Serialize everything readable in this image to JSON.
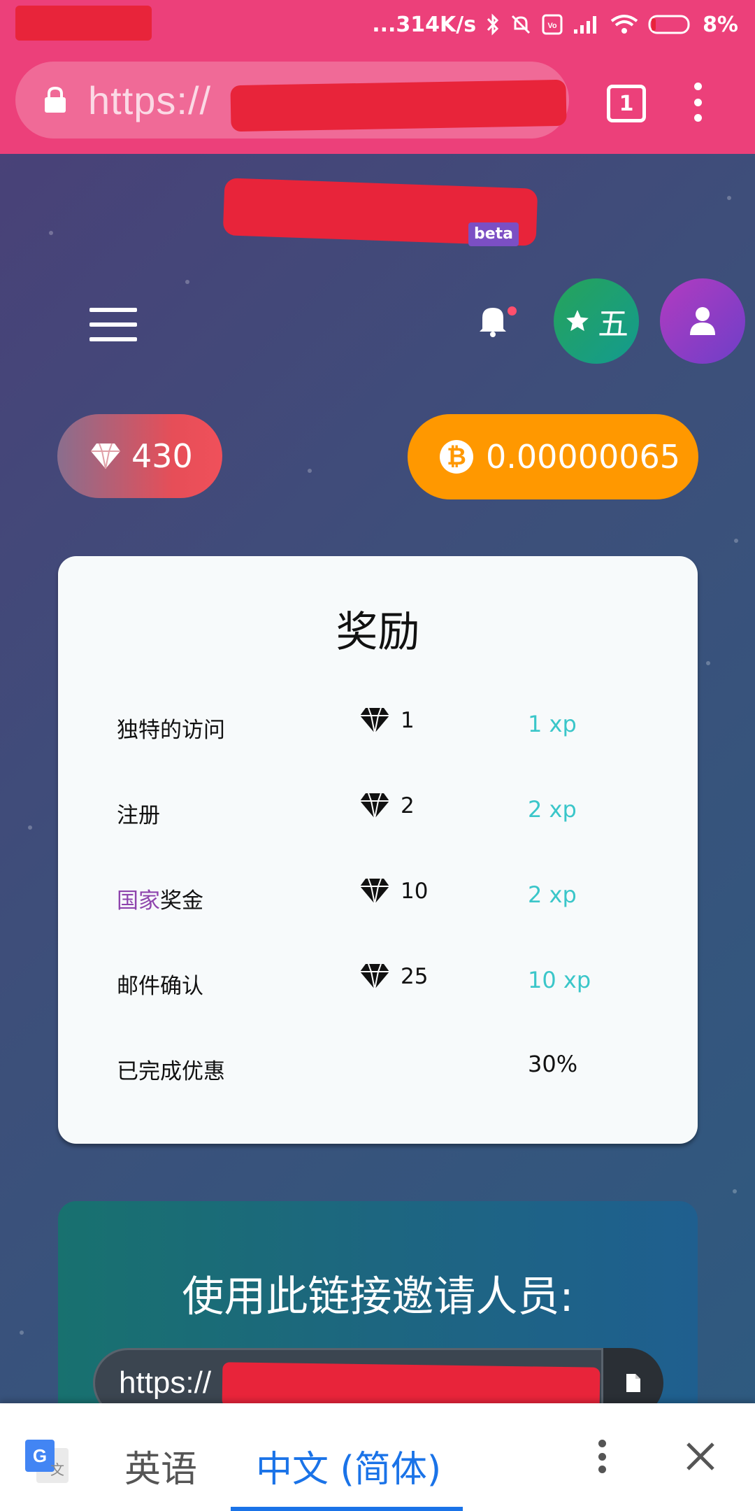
{
  "status_bar": {
    "network_speed": "...314K/s",
    "battery": "8%"
  },
  "browser": {
    "url_prefix": "https://",
    "tab_count": "1"
  },
  "site": {
    "badge": "beta"
  },
  "nav": {
    "level_label": "五"
  },
  "balances": {
    "gems": "430",
    "btc": "0.00000065"
  },
  "rewards": {
    "title": "奖励",
    "rows": [
      {
        "label": "独特的访问",
        "gems": "1",
        "xp": "1 xp"
      },
      {
        "label": "注册",
        "gems": "2",
        "xp": "2 xp"
      },
      {
        "label_accent": "国家",
        "label": "奖金",
        "gems": "10",
        "xp": "2 xp"
      },
      {
        "label": "邮件确认",
        "gems": "25",
        "xp": "10 xp"
      },
      {
        "label": "已完成优惠",
        "percent": "30%"
      }
    ]
  },
  "invite": {
    "title": "使用此链接邀请人员:",
    "link_prefix": "https://"
  },
  "translate_bar": {
    "source_lang": "英语",
    "target_lang": "中文 (简体)"
  },
  "colors": {
    "browser_chrome": "#ec407a",
    "btc_pill": "#ff9800",
    "xp_text": "#3ac6c9",
    "translate_accent": "#1a73e8"
  }
}
